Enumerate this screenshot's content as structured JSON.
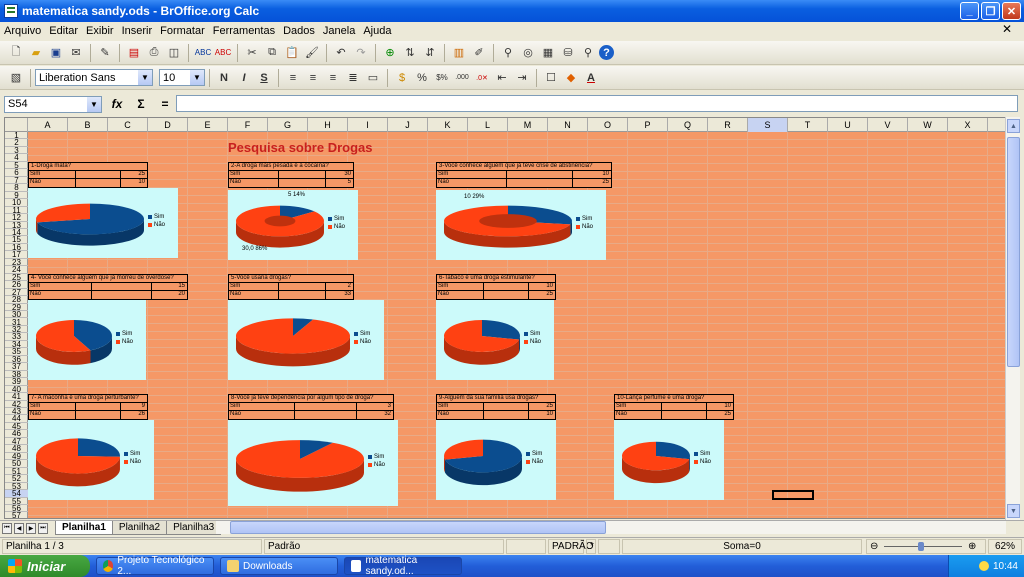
{
  "window": {
    "title": "matematica sandy.ods - BrOffice.org Calc"
  },
  "menu": [
    "Arquivo",
    "Editar",
    "Exibir",
    "Inserir",
    "Formatar",
    "Ferramentas",
    "Dados",
    "Janela",
    "Ajuda"
  ],
  "format_bar": {
    "font_name": "Liberation Sans",
    "font_size": "10"
  },
  "formula_bar": {
    "name_box": "S54",
    "formula": ""
  },
  "sheet": {
    "title": "Pesquisa sobre Drogas",
    "columns": [
      "A",
      "B",
      "C",
      "D",
      "E",
      "F",
      "G",
      "H",
      "I",
      "J",
      "K",
      "L",
      "M",
      "N",
      "O",
      "P",
      "Q",
      "R",
      "S",
      "T",
      "U",
      "V",
      "W",
      "X"
    ],
    "rows": [
      "1",
      "2",
      "3",
      "4",
      "5",
      "6",
      "7",
      "8",
      "9",
      "10",
      "11",
      "12",
      "13",
      "14",
      "15",
      "16",
      "17",
      "23",
      "24",
      "25",
      "26",
      "27",
      "28",
      "29",
      "30",
      "31",
      "32",
      "33",
      "34",
      "35",
      "36",
      "37",
      "38",
      "39",
      "40",
      "41",
      "42",
      "43",
      "44",
      "45",
      "46",
      "47",
      "48",
      "49",
      "50",
      "51",
      "52",
      "53",
      "54",
      "55",
      "56",
      "57"
    ],
    "questions": [
      {
        "q": "1-Droga mata?",
        "sim": "25",
        "nao": "10"
      },
      {
        "q": "2-A droga mais pesada é a cocaína?",
        "sim": "30",
        "nao": "5"
      },
      {
        "q": "3-Você conhece alguém que já teve crise de abstinência?",
        "sim": "10",
        "nao": "25"
      },
      {
        "q": "4- Você conhece alguém que já morreu de overdose?",
        "sim": "15",
        "nao": "20"
      },
      {
        "q": "5-Você usaria drogas?",
        "sim": "2",
        "nao": "33"
      },
      {
        "q": "6-Tabaco é uma droga estimulante?",
        "sim": "10",
        "nao": "25"
      },
      {
        "q": "7- A maconha é uma droga perturbante?",
        "sim": "9",
        "nao": "26"
      },
      {
        "q": "8-Você já teve dependência por algum tipo de droga?",
        "sim": "3",
        "nao": "32"
      },
      {
        "q": "9-Alguém da sua família usa drogas?",
        "sim": "25",
        "nao": "10"
      },
      {
        "q": "10-Lança perfume é uma droga?",
        "sim": "10",
        "nao": "25"
      }
    ],
    "legend": {
      "sim": "Sim",
      "nao": "Não"
    },
    "chart_labels": {
      "c2a": "5  14%",
      "c2b": "30,0  86%",
      "c3a": "10  29%"
    },
    "tabs": [
      "Planilha1",
      "Planilha2",
      "Planilha3"
    ]
  },
  "colors": {
    "sim": "#0b4d8f",
    "nao": "#ff4112",
    "chart_bg": "#ccfafa",
    "cell_bg": "#f59866"
  },
  "status": {
    "sheet": "Planilha 1 / 3",
    "style": "Padrão",
    "mode": "PADRÃO",
    "star": "*",
    "sum": "Soma=0",
    "zoom": "62%"
  },
  "taskbar": {
    "start": "Iniciar",
    "items": [
      "Projeto Tecnológico 2...",
      "Downloads",
      "matematica sandy.od..."
    ],
    "time": "10:44"
  },
  "chart_data": [
    {
      "type": "pie",
      "title": "",
      "categories": [
        "Sim",
        "Não"
      ],
      "values": [
        25,
        10
      ]
    },
    {
      "type": "pie",
      "title": "",
      "categories": [
        "Sim",
        "Não"
      ],
      "values": [
        5,
        30
      ]
    },
    {
      "type": "pie",
      "title": "",
      "categories": [
        "Sim",
        "Não"
      ],
      "values": [
        10,
        25
      ]
    },
    {
      "type": "pie",
      "title": "",
      "categories": [
        "Sim",
        "Não"
      ],
      "values": [
        15,
        20
      ]
    },
    {
      "type": "pie",
      "title": "",
      "categories": [
        "Sim",
        "Não"
      ],
      "values": [
        2,
        33
      ]
    },
    {
      "type": "pie",
      "title": "",
      "categories": [
        "Sim",
        "Não"
      ],
      "values": [
        10,
        25
      ]
    },
    {
      "type": "pie",
      "title": "",
      "categories": [
        "Sim",
        "Não"
      ],
      "values": [
        9,
        26
      ]
    },
    {
      "type": "pie",
      "title": "",
      "categories": [
        "Sim",
        "Não"
      ],
      "values": [
        3,
        32
      ]
    },
    {
      "type": "pie",
      "title": "",
      "categories": [
        "Sim",
        "Não"
      ],
      "values": [
        25,
        10
      ]
    },
    {
      "type": "pie",
      "title": "",
      "categories": [
        "Sim",
        "Não"
      ],
      "values": [
        10,
        25
      ]
    }
  ]
}
